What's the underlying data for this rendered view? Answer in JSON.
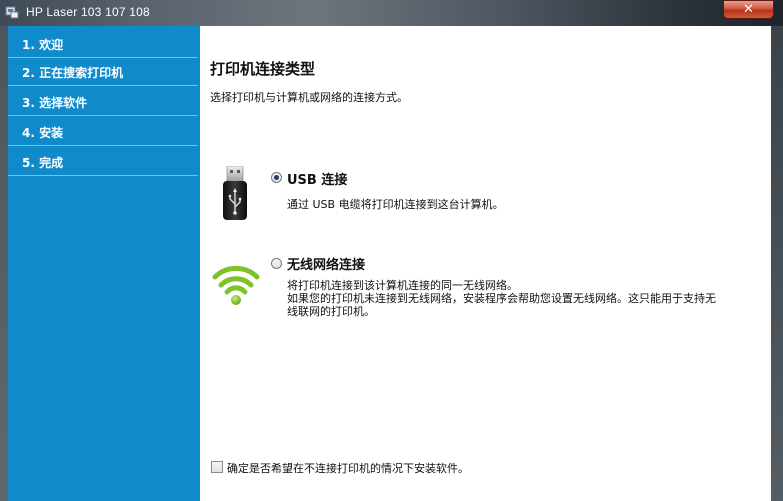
{
  "window": {
    "title": "HP Laser 103 107 108",
    "close_label": "✕"
  },
  "sidebar": {
    "items": [
      {
        "label": "1. 欢迎"
      },
      {
        "label": "2. 正在搜索打印机"
      },
      {
        "label": "3. 选择软件"
      },
      {
        "label": "4. 安装"
      },
      {
        "label": "5. 完成"
      }
    ]
  },
  "main": {
    "heading": "打印机连接类型",
    "subtitle": "选择打印机与计算机或网络的连接方式。",
    "options": [
      {
        "icon": "usb-icon",
        "label": "USB 连接",
        "selected": true,
        "description": [
          "通过 USB 电缆将打印机连接到这台计算机。"
        ]
      },
      {
        "icon": "wifi-icon",
        "label": "无线网络连接",
        "selected": false,
        "description": [
          "将打印机连接到该计算机连接的同一无线网络。",
          "如果您的打印机未连接到无线网络，安装程序会帮助您设置无线网络。这只能用于支持无",
          "线联网的打印机。"
        ]
      }
    ],
    "no_connect_checkbox": {
      "label": "确定是否希望在不连接打印机的情况下安装软件。",
      "checked": false
    }
  },
  "colors": {
    "sidebar": "#0f8acb",
    "sidebar_divider": "#6fc3ee",
    "wifi_green": "#7cc42a"
  }
}
